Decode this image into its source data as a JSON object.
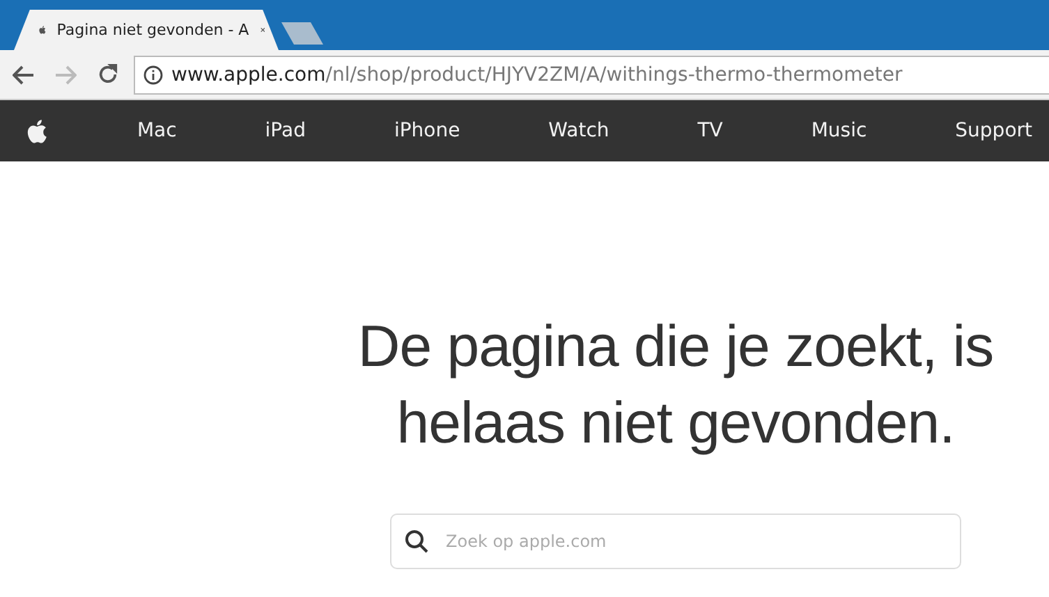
{
  "browser": {
    "tab": {
      "title": "Pagina niet gevonden - A",
      "selected": true
    },
    "address": {
      "host": "www.apple.com",
      "path": "/nl/shop/product/HJYV2ZM/A/withings-thermo-thermometer"
    }
  },
  "nav": {
    "items": [
      {
        "label": "Mac"
      },
      {
        "label": "iPad"
      },
      {
        "label": "iPhone"
      },
      {
        "label": "Watch"
      },
      {
        "label": "TV"
      },
      {
        "label": "Music"
      },
      {
        "label": "Support"
      }
    ]
  },
  "main": {
    "heading": [
      "De pagina die je zoekt, is",
      "helaas niet gevonden."
    ],
    "search": {
      "placeholder": "Zoek op apple.com"
    }
  }
}
